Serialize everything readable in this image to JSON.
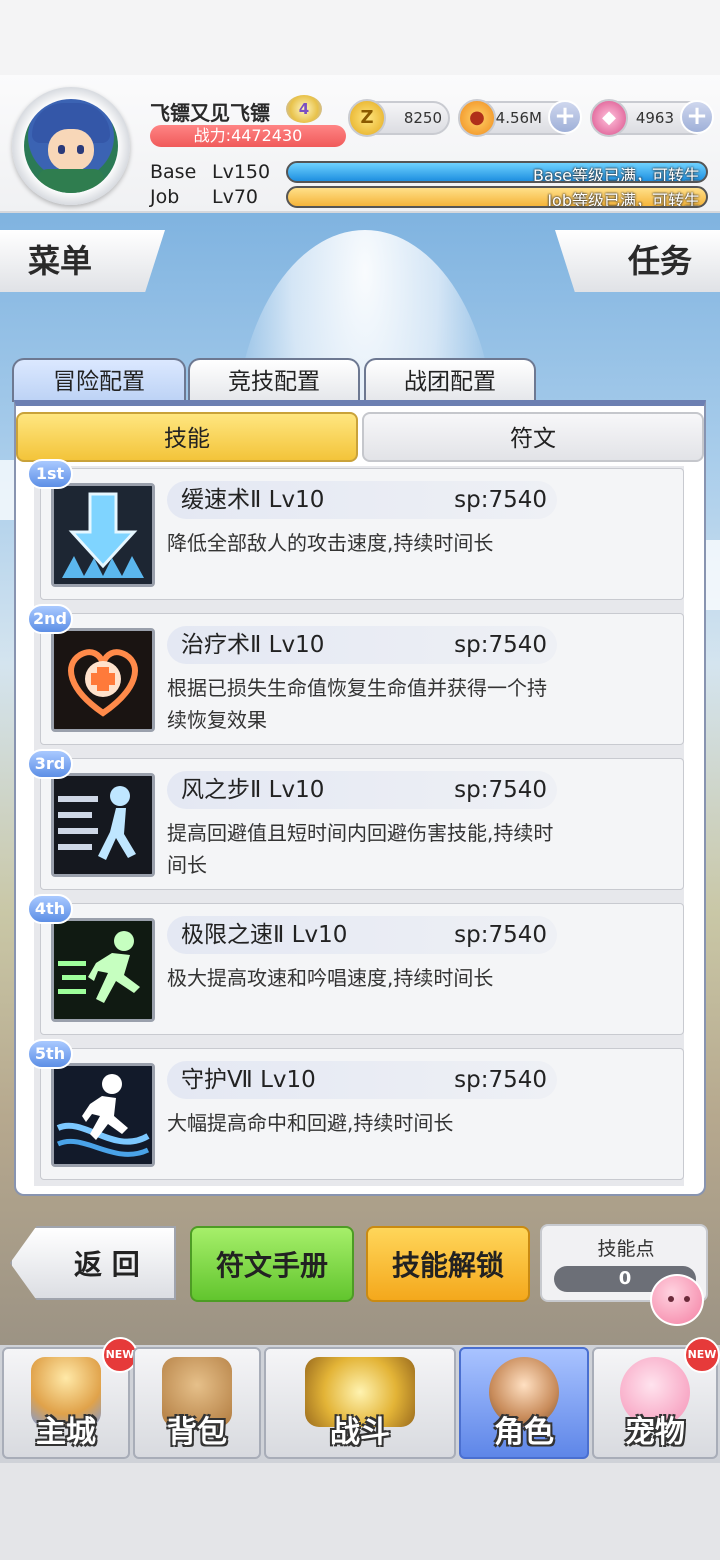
{
  "header": {
    "player_name": "飞镖又见飞镖",
    "vip_level": "4",
    "power": "战力:4472430",
    "currencies": [
      {
        "icon": "zeny-coin-icon",
        "glyph": "Z",
        "value": "8250",
        "has_plus": false
      },
      {
        "icon": "gold-coin-icon",
        "glyph": "●",
        "value": "4.56M",
        "has_plus": true
      },
      {
        "icon": "pink-gem-icon",
        "glyph": "◆",
        "value": "4963",
        "has_plus": true
      }
    ],
    "base": {
      "label": "Base",
      "level": "Lv150",
      "status": "Base等级已满，可转生"
    },
    "job": {
      "label": "Job",
      "level": "Lv70",
      "status": "Job等级已满，可转生"
    }
  },
  "ribbons": {
    "menu": "菜单",
    "quest": "任务"
  },
  "tabs": [
    "冒险配置",
    "竞技配置",
    "战团配置"
  ],
  "subtabs": {
    "skill": "技能",
    "rune": "符文"
  },
  "skills": [
    {
      "rank": "1st",
      "name": "缓速术Ⅱ",
      "level": "Lv10",
      "sp": "sp:7540",
      "desc": "降低全部敌人的攻击速度,持续时间长",
      "icon": "slow-arrow-icon"
    },
    {
      "rank": "2nd",
      "name": "治疗术Ⅱ",
      "level": "Lv10",
      "sp": "sp:7540",
      "desc": "根据已损失生命值恢复生命值并获得一个持续恢复效果",
      "icon": "heal-heart-icon"
    },
    {
      "rank": "3rd",
      "name": "风之步Ⅱ",
      "level": "Lv10",
      "sp": "sp:7540",
      "desc": "提高回避值且短时间内回避伤害技能,持续时间长",
      "icon": "wind-step-icon"
    },
    {
      "rank": "4th",
      "name": "极限之速Ⅱ",
      "level": "Lv10",
      "sp": "sp:7540",
      "desc": "极大提高攻速和吟唱速度,持续时间长",
      "icon": "sprint-icon"
    },
    {
      "rank": "5th",
      "name": "守护Ⅶ",
      "level": "Lv10",
      "sp": "sp:7540",
      "desc": "大幅提高命中和回避,持续时间长",
      "icon": "guard-run-icon"
    }
  ],
  "actions": {
    "back": "返 回",
    "rune_manual": "符文手册",
    "skill_unlock": "技能解锁",
    "skill_points_label": "技能点",
    "skill_points": "0"
  },
  "nav": [
    {
      "label": "主城",
      "icon": "castle-icon",
      "new": true,
      "active": false
    },
    {
      "label": "背包",
      "icon": "backpack-icon",
      "new": false,
      "active": false
    },
    {
      "label": "战斗",
      "icon": "crossed-swords-icon",
      "new": false,
      "active": true
    },
    {
      "label": "角色",
      "icon": "character-icon",
      "new": false,
      "active": true
    },
    {
      "label": "宠物",
      "icon": "pet-poring-icon",
      "new": true,
      "active": false
    }
  ],
  "new_badge": "NEW",
  "colors": {
    "accent_blue": "#5e86e8",
    "power_red": "#f05a5a",
    "skill_tab_yellow": "#f3c43a",
    "green_button": "#62c52e",
    "orange_button": "#f4a81c"
  }
}
